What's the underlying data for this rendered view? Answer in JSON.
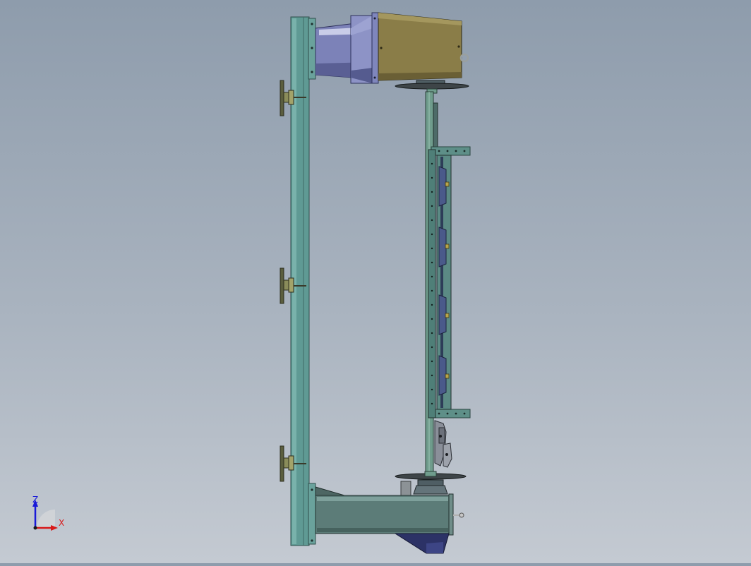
{
  "view": {
    "background_top": "#8e9cac",
    "background_bottom": "#c4cad2"
  },
  "triad": {
    "z_label": "Z",
    "x_label": "X",
    "z_color": "#1a1ad8",
    "x_color": "#d81a1a"
  },
  "colors": {
    "frame_teal": "#5f9a94",
    "frame_edge": "#2f4f4b",
    "motor_olive": "#8a7d48",
    "adapter_blue": "#7c82b8",
    "shaft_green": "#6f9c8c",
    "knob_dark": "#5b5e3e",
    "base_slate": "#5c7c78",
    "gear_navy": "#2c3266"
  },
  "model": {
    "parts": [
      "left-column",
      "adjust-knob",
      "adjust-knob",
      "adjust-knob",
      "adapter-flange",
      "motor-housing",
      "top-disc",
      "vertical-shaft",
      "rack-assembly",
      "lower-clamp",
      "bottom-disc",
      "base-beam",
      "gearbox"
    ]
  }
}
